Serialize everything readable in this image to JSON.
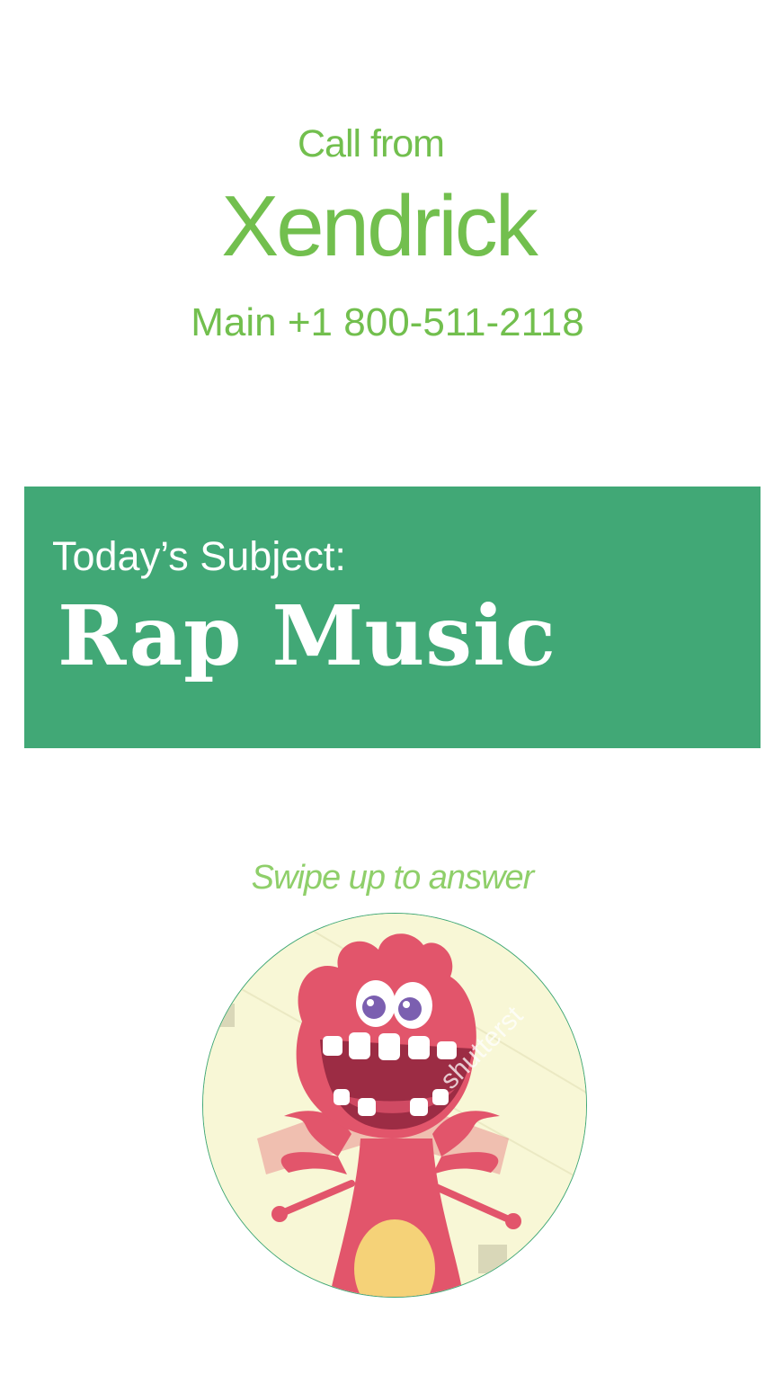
{
  "call": {
    "header_label": "Call from",
    "caller_name": "Xendrick",
    "caller_number": "Main +1 800-511-2118"
  },
  "subject": {
    "label": "Today’s Subject:",
    "value": "Rap Music"
  },
  "answer": {
    "hint": "Swipe up to answer",
    "avatar_icon": "monster-avatar-icon",
    "watermark": "shutterst"
  },
  "colors": {
    "accent_text": "#72bf4e",
    "hint_text": "#8fcf6a",
    "banner": "#41a876",
    "avatar_bg": "#f8f7d6",
    "monster": "#e2556b"
  }
}
